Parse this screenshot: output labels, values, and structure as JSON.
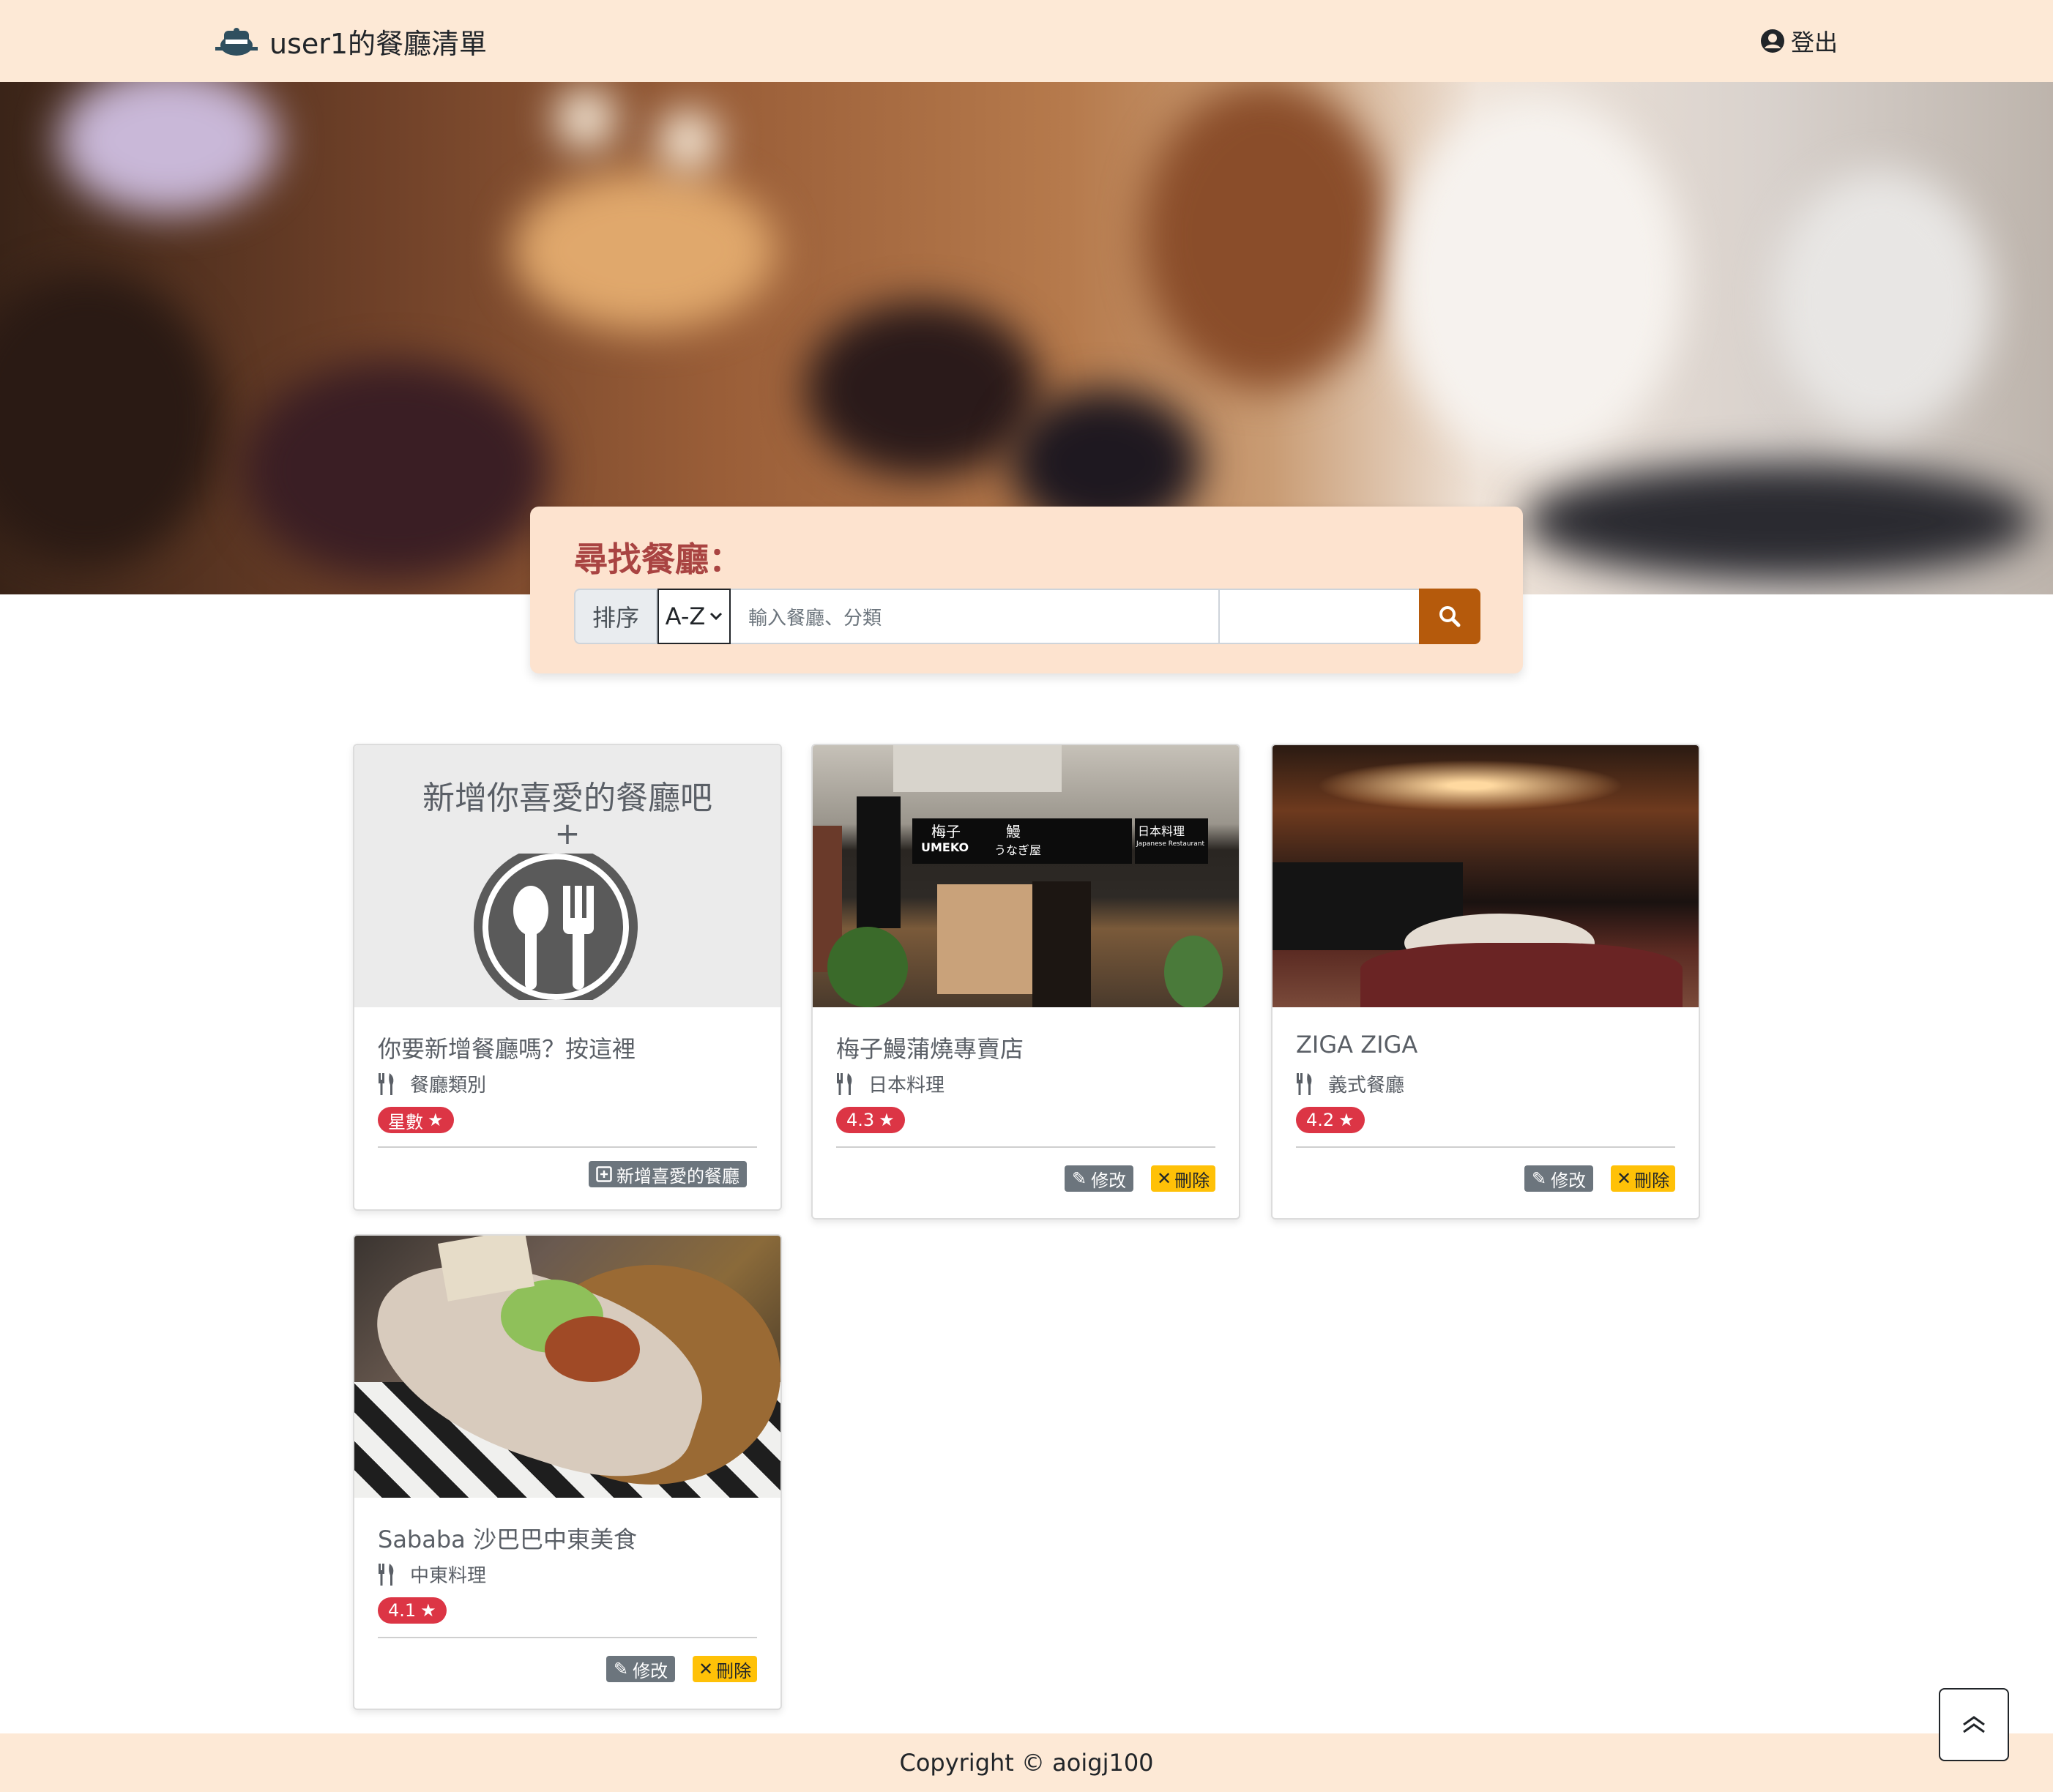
{
  "nav": {
    "brand": "user1的餐廳清單",
    "logout": "登出"
  },
  "search": {
    "title": "尋找餐廳：",
    "sort_label": "排序",
    "sort_selected": "A-Z",
    "placeholder": "輸入餐廳、分類"
  },
  "add_card": {
    "heading": "新增你喜愛的餐廳吧",
    "plus": "+",
    "title": "你要新增餐廳嗎？按這裡",
    "category": "餐廳類別",
    "rating": "星數",
    "button": "新增喜愛的餐廳"
  },
  "restaurants": [
    {
      "name": "梅子鰻蒲燒專賣店",
      "category": "日本料理",
      "rating": "4.3"
    },
    {
      "name": "ZIGA ZIGA",
      "category": "義式餐廳",
      "rating": "4.2"
    },
    {
      "name": "Sababa 沙巴巴中東美食",
      "category": "中東料理",
      "rating": "4.1"
    }
  ],
  "actions": {
    "edit": "修改",
    "delete": "刪除"
  },
  "storefront_signs": {
    "umeko_jp": "梅子",
    "umeko_en": "UMEKO",
    "unagi": "鰻",
    "unagi_ya": "うなぎ屋",
    "nihon": "日本料理",
    "japanese": "Japanese Restaurant"
  },
  "footer": {
    "copyright": "Copyright © aoigj100"
  },
  "colors": {
    "navbar_bg": "#fde9d6",
    "panel_bg": "#fde3cf",
    "title_red": "#a94442",
    "search_btn": "#b55a0c",
    "rating_badge": "#dc3545",
    "edit_btn": "#6c757d",
    "delete_btn": "#ffc107"
  },
  "icons": {
    "brand": "restaurant-logo-icon",
    "logout": "user-circle-icon",
    "search": "search-icon",
    "category": "utensils-icon",
    "rating": "star-icon",
    "edit": "edit-icon",
    "delete": "times-icon",
    "add": "plus-square-icon",
    "scroll_top": "double-chevron-up-icon"
  }
}
